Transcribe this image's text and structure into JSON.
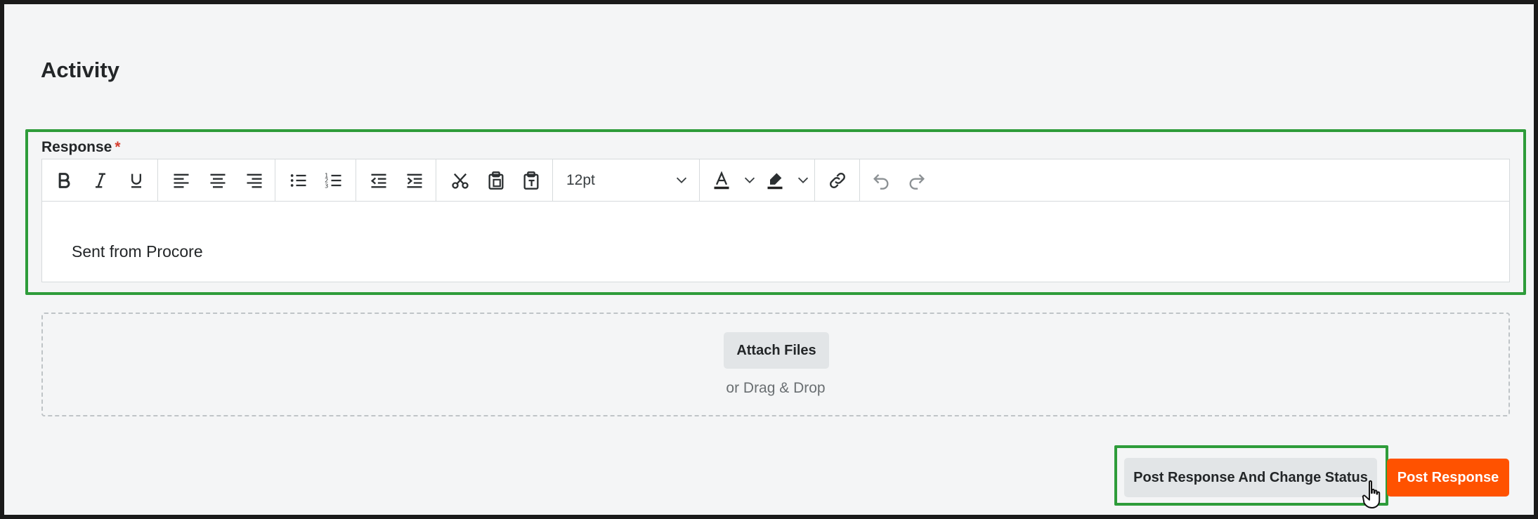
{
  "section": {
    "title": "Activity"
  },
  "response": {
    "label": "Response",
    "required_marker": "*",
    "content": "Sent from Procore"
  },
  "toolbar": {
    "font_size": "12pt",
    "icons": [
      "bold-icon",
      "italic-icon",
      "underline-icon",
      "align-left-icon",
      "align-center-icon",
      "align-right-icon",
      "bulleted-list-icon",
      "numbered-list-icon",
      "outdent-icon",
      "indent-icon",
      "cut-icon",
      "paste-icon",
      "paste-as-text-icon",
      "text-color-icon",
      "highlight-color-icon",
      "link-icon",
      "undo-icon",
      "redo-icon"
    ]
  },
  "attachments": {
    "button_label": "Attach Files",
    "hint": "or Drag & Drop"
  },
  "actions": {
    "secondary_label": "Post Response And Change Status",
    "primary_label": "Post Response"
  },
  "colors": {
    "primary": "#ff5200",
    "highlight_outline": "#2e9c3a",
    "required": "#d63d2e"
  }
}
